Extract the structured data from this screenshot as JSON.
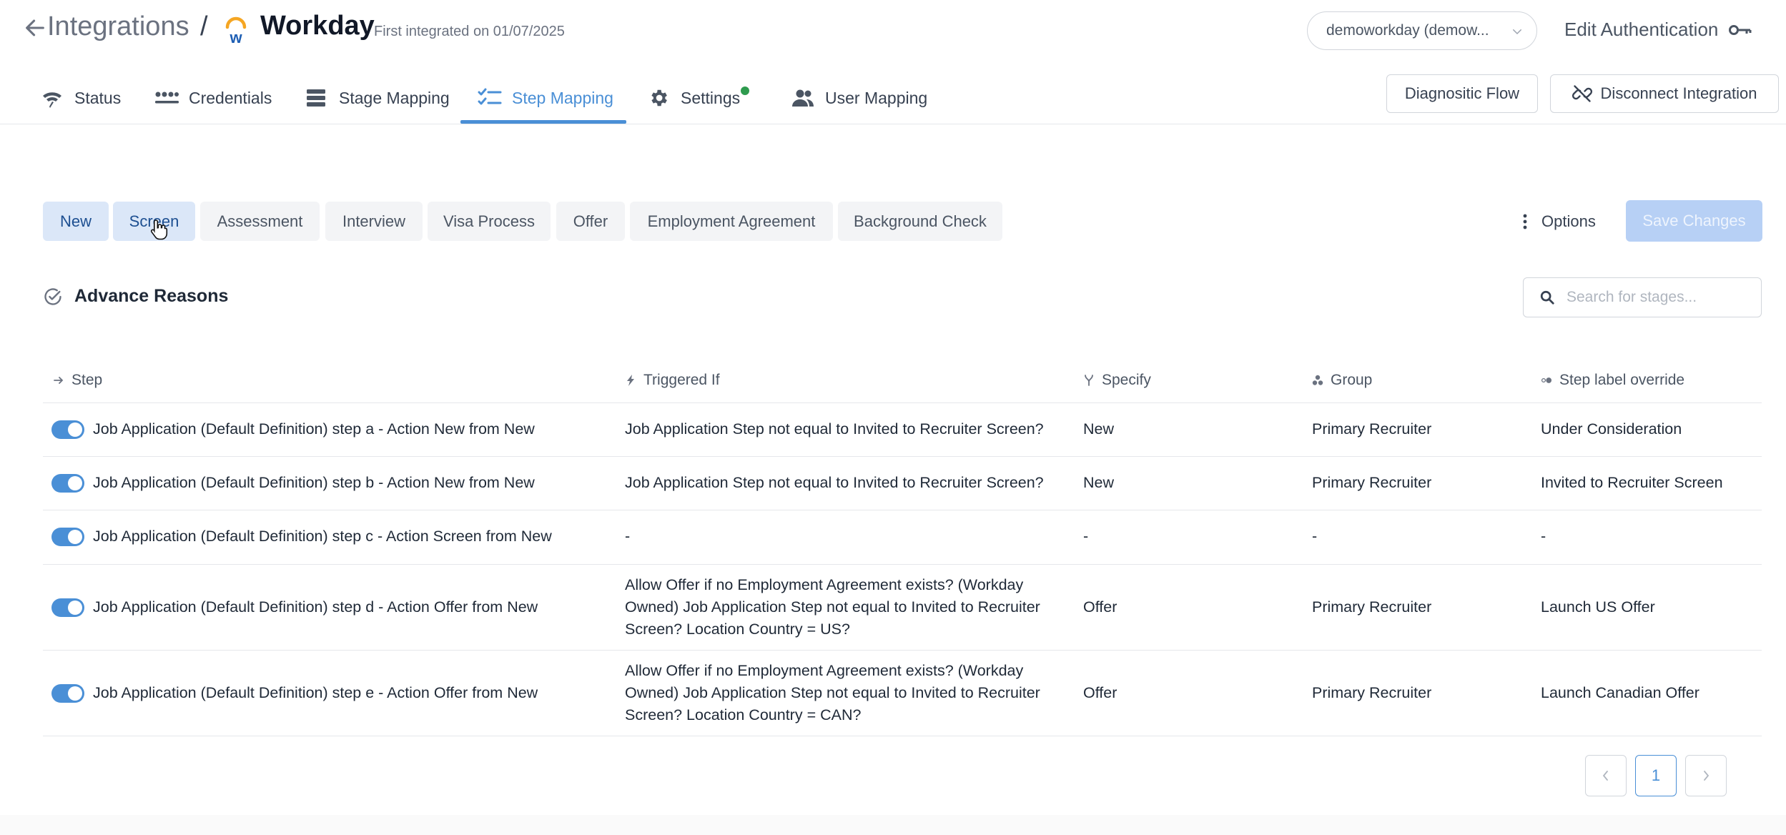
{
  "header": {
    "breadcrumb_root": "Integrations",
    "breadcrumb_sep": "/",
    "title": "Workday",
    "subtitle": "First integrated on 01/07/2025",
    "account_select": "demoworkday (demow...",
    "edit_auth_label": "Edit Authentication"
  },
  "tabs": [
    {
      "label": "Status",
      "icon": "wifi-icon"
    },
    {
      "label": "Credentials",
      "icon": "dots-icon"
    },
    {
      "label": "Stage Mapping",
      "icon": "stack-icon"
    },
    {
      "label": "Step Mapping",
      "icon": "checklist-icon",
      "active": true
    },
    {
      "label": "Settings",
      "icon": "gear-icon",
      "status_dot": "#2e9b4e"
    },
    {
      "label": "User Mapping",
      "icon": "users-icon"
    }
  ],
  "actions": {
    "diagnostic_label": "Diagnositic Flow",
    "disconnect_label": "Disconnect Integration"
  },
  "stages": {
    "items": [
      "New",
      "Screen",
      "Assessment",
      "Interview",
      "Visa Process",
      "Offer",
      "Employment Agreement",
      "Background Check"
    ],
    "selected": "New",
    "hovered": "Screen"
  },
  "toolbar": {
    "options_label": "Options",
    "save_label": "Save Changes"
  },
  "section": {
    "title": "Advance Reasons",
    "search_placeholder": "Search for stages..."
  },
  "table": {
    "columns": [
      "Step",
      "Triggered If",
      "Specify",
      "Group",
      "Step label override"
    ],
    "rows": [
      {
        "enabled": true,
        "step": "Job Application (Default Definition) step a - Action New from New",
        "triggered": "Job Application Step not equal to Invited to Recruiter Screen?",
        "specify": "New",
        "group": "Primary Recruiter",
        "override": "Under Consideration"
      },
      {
        "enabled": true,
        "step": "Job Application (Default Definition) step b - Action New from New",
        "triggered": "Job Application Step not equal to Invited to Recruiter Screen?",
        "specify": "New",
        "group": "Primary Recruiter",
        "override": "Invited to Recruiter Screen"
      },
      {
        "enabled": true,
        "step": "Job Application (Default Definition) step c - Action Screen from New",
        "triggered": "-",
        "specify": "-",
        "group": "-",
        "override": "-"
      },
      {
        "enabled": true,
        "step": "Job Application (Default Definition) step d - Action Offer from New",
        "triggered": "Allow Offer if no Employment Agreement exists? (Workday Owned) Job Application Step not equal to Invited to Recruiter Screen? Location Country = US?",
        "specify": "Offer",
        "group": "Primary Recruiter",
        "override": "Launch US Offer"
      },
      {
        "enabled": true,
        "step": "Job Application (Default Definition) step e - Action Offer from New",
        "triggered": "Allow Offer if no Employment Agreement exists? (Workday Owned) Job Application Step not equal to Invited to Recruiter Screen? Location Country = CAN?",
        "specify": "Offer",
        "group": "Primary Recruiter",
        "override": "Launch Canadian Offer"
      }
    ]
  },
  "pagination": {
    "current_page": "1"
  },
  "colors": {
    "accent": "#4a8fd6",
    "save_disabled": "#b7d0f5",
    "pill_selected": "#dbe7f8",
    "status_green": "#2e9b4e"
  }
}
